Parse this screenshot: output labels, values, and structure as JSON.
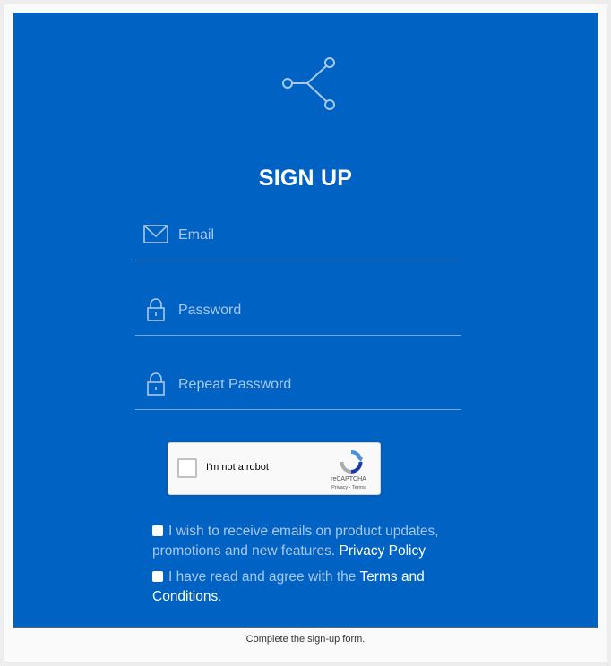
{
  "form": {
    "title": "SIGN UP",
    "email_placeholder": "Email",
    "password_placeholder": "Password",
    "repeat_password_placeholder": "Repeat Password"
  },
  "recaptcha": {
    "label": "I'm not a robot",
    "brand": "reCAPTCHA",
    "links": "Privacy - Terms"
  },
  "consent": {
    "emails_text": "I wish to receive emails on product updates, promotions and new features.",
    "privacy_link": "Privacy Policy",
    "terms_prefix": "I have read and agree with the",
    "terms_link": "Terms and Conditions",
    "terms_suffix": "."
  },
  "caption": "Complete the sign-up form.",
  "colors": {
    "panel": "#0062c3",
    "placeholder": "#a9c8ee",
    "divider": "#7aa8e0"
  },
  "icons": [
    "share-nodes-icon",
    "envelope-icon",
    "lock-icon",
    "recaptcha-logo-icon"
  ]
}
